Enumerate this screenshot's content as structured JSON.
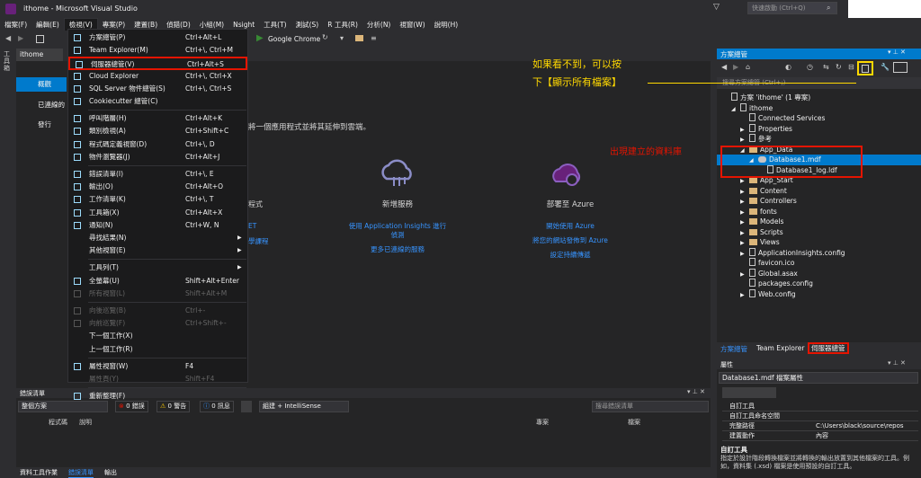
{
  "window": {
    "title": "ithome - Microsoft Visual Studio",
    "quick_launch": "快速啟動 (Ctrl+Q)"
  },
  "menubar": [
    "檔案(F)",
    "編輯(E)",
    "檢視(V)",
    "專案(P)",
    "建置(B)",
    "偵錯(D)",
    "小組(M)",
    "Nsight",
    "工具(T)",
    "測試(S)",
    "R 工具(R)",
    "分析(N)",
    "視窗(W)",
    "說明(H)"
  ],
  "toolbar": {
    "run_target": "Google Chrome"
  },
  "document": {
    "tab": "ithome",
    "nav": [
      "概觀",
      "已連線的",
      "發行"
    ],
    "hero_text": "將一個應用程式並將其延伸到雲端。",
    "partial1": "程式",
    "partial2": "ET",
    "partial3": "學課程",
    "cards": [
      {
        "title": "新增服務",
        "links": [
          "使用 Application Insights 進行",
          "偵測",
          "更多已連線的服務"
        ]
      },
      {
        "title": "部署至 Azure",
        "links": [
          "開始使用 Azure",
          "將您的網站發佈到 Azure",
          "設定持續傳遞"
        ]
      }
    ]
  },
  "view_menu": {
    "items": [
      {
        "label": "方案總管(P)",
        "shortcut": "Ctrl+Alt+L",
        "icon": "solution-explorer-icon"
      },
      {
        "label": "Team Explorer(M)",
        "shortcut": "Ctrl+\\, Ctrl+M",
        "icon": "team-explorer-icon"
      },
      {
        "label": "伺服器總管(V)",
        "shortcut": "Ctrl+Alt+S",
        "icon": "server-explorer-icon",
        "highlight": true
      },
      {
        "label": "Cloud Explorer",
        "shortcut": "Ctrl+\\, Ctrl+X",
        "icon": "cloud-explorer-icon"
      },
      {
        "label": "SQL Server 物件總管(S)",
        "shortcut": "Ctrl+\\, Ctrl+S",
        "icon": "sql-server-icon"
      },
      {
        "label": "Cookiecutter 總管(C)",
        "shortcut": "",
        "icon": "cookiecutter-icon"
      },
      {
        "sep": true
      },
      {
        "label": "呼叫階層(H)",
        "shortcut": "Ctrl+Alt+K",
        "icon": "call-hierarchy-icon"
      },
      {
        "label": "類別檢視(A)",
        "shortcut": "Ctrl+Shift+C",
        "icon": "class-view-icon"
      },
      {
        "label": "程式碼定義視窗(D)",
        "shortcut": "Ctrl+\\, D",
        "icon": "code-definition-icon"
      },
      {
        "label": "物件瀏覽器(J)",
        "shortcut": "Ctrl+Alt+J",
        "icon": "object-browser-icon"
      },
      {
        "sep": true
      },
      {
        "label": "錯誤清單(I)",
        "shortcut": "Ctrl+\\, E",
        "icon": "error-list-icon"
      },
      {
        "label": "輸出(O)",
        "shortcut": "Ctrl+Alt+O",
        "icon": "output-icon"
      },
      {
        "label": "工作清單(K)",
        "shortcut": "Ctrl+\\, T",
        "icon": "task-list-icon"
      },
      {
        "label": "工具箱(X)",
        "shortcut": "Ctrl+Alt+X",
        "icon": "toolbox-icon"
      },
      {
        "label": "通知(N)",
        "shortcut": "Ctrl+W, N",
        "icon": "notifications-icon"
      },
      {
        "label": "尋找結果(N)",
        "shortcut": "",
        "submenu": true
      },
      {
        "label": "其他視窗(E)",
        "shortcut": "",
        "submenu": true
      },
      {
        "sep": true
      },
      {
        "label": "工具列(T)",
        "shortcut": "",
        "submenu": true
      },
      {
        "label": "全螢幕(U)",
        "shortcut": "Shift+Alt+Enter",
        "icon": "fullscreen-icon"
      },
      {
        "label": "所有視窗(L)",
        "shortcut": "Shift+Alt+M",
        "icon": "all-windows-icon",
        "disabled": true
      },
      {
        "sep": true
      },
      {
        "label": "向後巡覽(B)",
        "shortcut": "Ctrl+-",
        "icon": "back-icon",
        "disabled": true
      },
      {
        "label": "向前巡覽(F)",
        "shortcut": "Ctrl+Shift+-",
        "icon": "forward-icon",
        "disabled": true
      },
      {
        "label": "下一個工作(X)",
        "shortcut": ""
      },
      {
        "label": "上一個工作(R)",
        "shortcut": ""
      },
      {
        "sep": true
      },
      {
        "label": "屬性視窗(W)",
        "shortcut": "F4",
        "icon": "wrench-icon"
      },
      {
        "label": "屬性頁(Y)",
        "shortcut": "Shift+F4",
        "disabled": true
      },
      {
        "sep": true
      },
      {
        "label": "重新整理(F)",
        "shortcut": "",
        "icon": "refresh-icon"
      }
    ]
  },
  "error_list": {
    "title": "錯誤清單",
    "scope": "整個方案",
    "errors": "0 錯誤",
    "warnings": "0 警告",
    "messages": "0 訊息",
    "build_filter": "組建 + IntelliSense",
    "columns": [
      "程式碼",
      "說明",
      "專案",
      "檔案"
    ],
    "search_placeholder": "搜尋錯誤清單"
  },
  "bottom_tabs": [
    "資料工具作業",
    "錯誤清單",
    "輸出"
  ],
  "solution_explorer": {
    "title": "方案總管",
    "search_placeholder": "搜尋方案總管 (Ctrl+;)",
    "tree": [
      {
        "label": "方案 'ithome' (1 專案)",
        "level": 0,
        "type": "solution"
      },
      {
        "label": "ithome",
        "level": 1,
        "type": "project",
        "expanded": true
      },
      {
        "label": "Connected Services",
        "level": 2,
        "type": "service"
      },
      {
        "label": "Properties",
        "level": 2,
        "type": "wrench",
        "arrow": true
      },
      {
        "label": "參考",
        "level": 2,
        "type": "ref",
        "arrow": true
      },
      {
        "label": "App_Data",
        "level": 2,
        "type": "folder",
        "expanded": true
      },
      {
        "label": "Database1.mdf",
        "level": 3,
        "type": "db",
        "expanded": true,
        "selected": true
      },
      {
        "label": "Database1_log.ldf",
        "level": 4,
        "type": "file"
      },
      {
        "label": "App_Start",
        "level": 2,
        "type": "folder",
        "arrow": true
      },
      {
        "label": "Content",
        "level": 2,
        "type": "folder",
        "arrow": true
      },
      {
        "label": "Controllers",
        "level": 2,
        "type": "folder",
        "arrow": true
      },
      {
        "label": "fonts",
        "level": 2,
        "type": "folder",
        "arrow": true
      },
      {
        "label": "Models",
        "level": 2,
        "type": "folder",
        "arrow": true
      },
      {
        "label": "Scripts",
        "level": 2,
        "type": "folder",
        "arrow": true
      },
      {
        "label": "Views",
        "level": 2,
        "type": "folder",
        "arrow": true
      },
      {
        "label": "ApplicationInsights.config",
        "level": 2,
        "type": "file",
        "arrow": true
      },
      {
        "label": "favicon.ico",
        "level": 2,
        "type": "file"
      },
      {
        "label": "Global.asax",
        "level": 2,
        "type": "file",
        "arrow": true
      },
      {
        "label": "packages.config",
        "level": 2,
        "type": "file"
      },
      {
        "label": "Web.config",
        "level": 2,
        "type": "file",
        "arrow": true
      }
    ],
    "tabs": [
      "方案總管",
      "Team Explorer",
      "伺服器總管"
    ]
  },
  "annotations": {
    "hint_line1": "如果看不到，可以按",
    "hint_line2": "下【顯示所有檔案】",
    "db_note": "出現建立的資料庫"
  },
  "properties": {
    "title": "屬性",
    "object": "Database1.mdf 檔案屬性",
    "rows": [
      {
        "name": "自訂工具",
        "value": ""
      },
      {
        "name": "自訂工具命名空間",
        "value": ""
      },
      {
        "name": "完整路徑",
        "value": "C:\\Users\\black\\source\\repos"
      },
      {
        "name": "建置動作",
        "value": "內容"
      }
    ],
    "desc_title": "自訂工具",
    "desc_text": "指定於設計階段轉換檔案並將轉換的輸出放置到其他檔案的工具。例如，資料集 (.xsd) 檔案是使用預設的自訂工具。"
  },
  "colors": {
    "accent": "#007acc",
    "red_box": "#e51400",
    "annotation": "#ffd800",
    "bg": "#2d2d30"
  }
}
